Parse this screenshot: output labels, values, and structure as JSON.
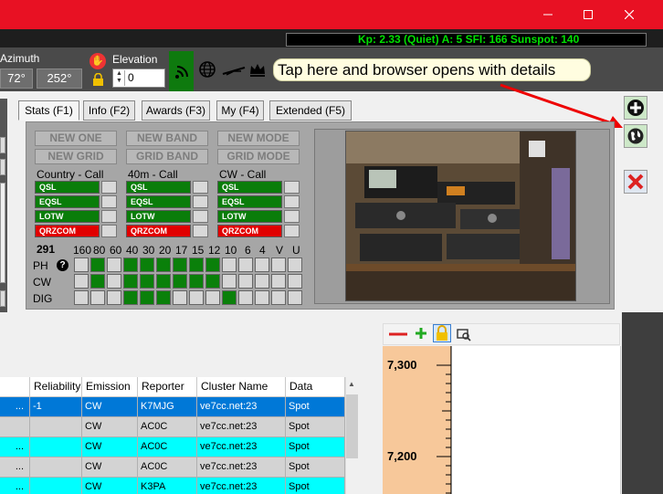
{
  "window": {
    "minimize_glyph": "—",
    "maximize_glyph": "☐",
    "close_glyph": "✕",
    "accent_color": "#e81123"
  },
  "solar": {
    "text": "Kp: 2.33 (Quiet)  A: 5  SFI: 166 Sunspot: 140"
  },
  "rotator": {
    "azimuth_label": "Azimuth",
    "azimuth_current": "72°",
    "azimuth_target": "252°",
    "elevation_label": "Elevation",
    "elevation_value": "0"
  },
  "callout": {
    "text": "Tap here and browser opens with details"
  },
  "tabs": [
    {
      "label": "Stats (F1)",
      "active": true
    },
    {
      "label": "Info (F2)",
      "active": false
    },
    {
      "label": "Awards (F3)",
      "active": false
    },
    {
      "label": "My (F4)",
      "active": false
    },
    {
      "label": "Extended (F5)",
      "active": false
    }
  ],
  "stats": {
    "buttons": [
      "NEW ONE",
      "NEW BAND",
      "NEW MODE",
      "NEW GRID",
      "GRID BAND",
      "GRID MODE"
    ],
    "columns": [
      {
        "title": "Country - Call",
        "cells": [
          {
            "label": "QSL",
            "status": "green"
          },
          {
            "label": "EQSL",
            "status": "green"
          },
          {
            "label": "LOTW",
            "status": "green"
          },
          {
            "label": "QRZCOM",
            "status": "red"
          }
        ]
      },
      {
        "title": "40m - Call",
        "cells": [
          {
            "label": "QSL",
            "status": "green"
          },
          {
            "label": "EQSL",
            "status": "green"
          },
          {
            "label": "LOTW",
            "status": "green"
          },
          {
            "label": "QRZCOM",
            "status": "red"
          }
        ]
      },
      {
        "title": "CW - Call",
        "cells": [
          {
            "label": "QSL",
            "status": "green"
          },
          {
            "label": "EQSL",
            "status": "green"
          },
          {
            "label": "LOTW",
            "status": "green"
          },
          {
            "label": "QRZCOM",
            "status": "red"
          }
        ]
      }
    ],
    "count": "291",
    "bands": [
      "160",
      "80",
      "60",
      "40",
      "30",
      "20",
      "17",
      "15",
      "12",
      "10",
      "6",
      "4",
      "V",
      "U"
    ],
    "modes": [
      {
        "label": "PH",
        "help": "?",
        "worked": [
          false,
          true,
          false,
          true,
          true,
          true,
          true,
          true,
          true,
          false,
          false,
          false,
          false,
          false
        ]
      },
      {
        "label": "CW",
        "help": "",
        "worked": [
          false,
          true,
          false,
          true,
          true,
          true,
          true,
          true,
          true,
          false,
          false,
          false,
          false,
          false
        ]
      },
      {
        "label": "DIG",
        "help": "",
        "worked": [
          false,
          false,
          false,
          true,
          true,
          true,
          false,
          false,
          false,
          true,
          false,
          false,
          false,
          false
        ]
      }
    ]
  },
  "spots": {
    "columns": [
      "Reliability",
      "Emission",
      "Reporter",
      "Cluster Name",
      "Data"
    ],
    "rows": [
      {
        "lead": "...",
        "reliability": "-1",
        "emission": "CW",
        "reporter": "K7MJG",
        "cluster": "ve7cc.net:23",
        "data": "Spot",
        "style": "selected"
      },
      {
        "lead": "",
        "reliability": "",
        "emission": "CW",
        "reporter": "AC0C",
        "cluster": "ve7cc.net:23",
        "data": "Spot",
        "style": "grey"
      },
      {
        "lead": "...",
        "reliability": "",
        "emission": "CW",
        "reporter": "AC0C",
        "cluster": "ve7cc.net:23",
        "data": "Spot",
        "style": "cyan"
      },
      {
        "lead": "...",
        "reliability": "",
        "emission": "CW",
        "reporter": "AC0C",
        "cluster": "ve7cc.net:23",
        "data": "Spot",
        "style": "grey"
      },
      {
        "lead": "...",
        "reliability": "",
        "emission": "CW",
        "reporter": "K3PA",
        "cluster": "ve7cc.net:23",
        "data": "Spot",
        "style": "cyan"
      }
    ]
  },
  "bandmap": {
    "freq_top": "7,300",
    "freq_mid": "7,200"
  }
}
